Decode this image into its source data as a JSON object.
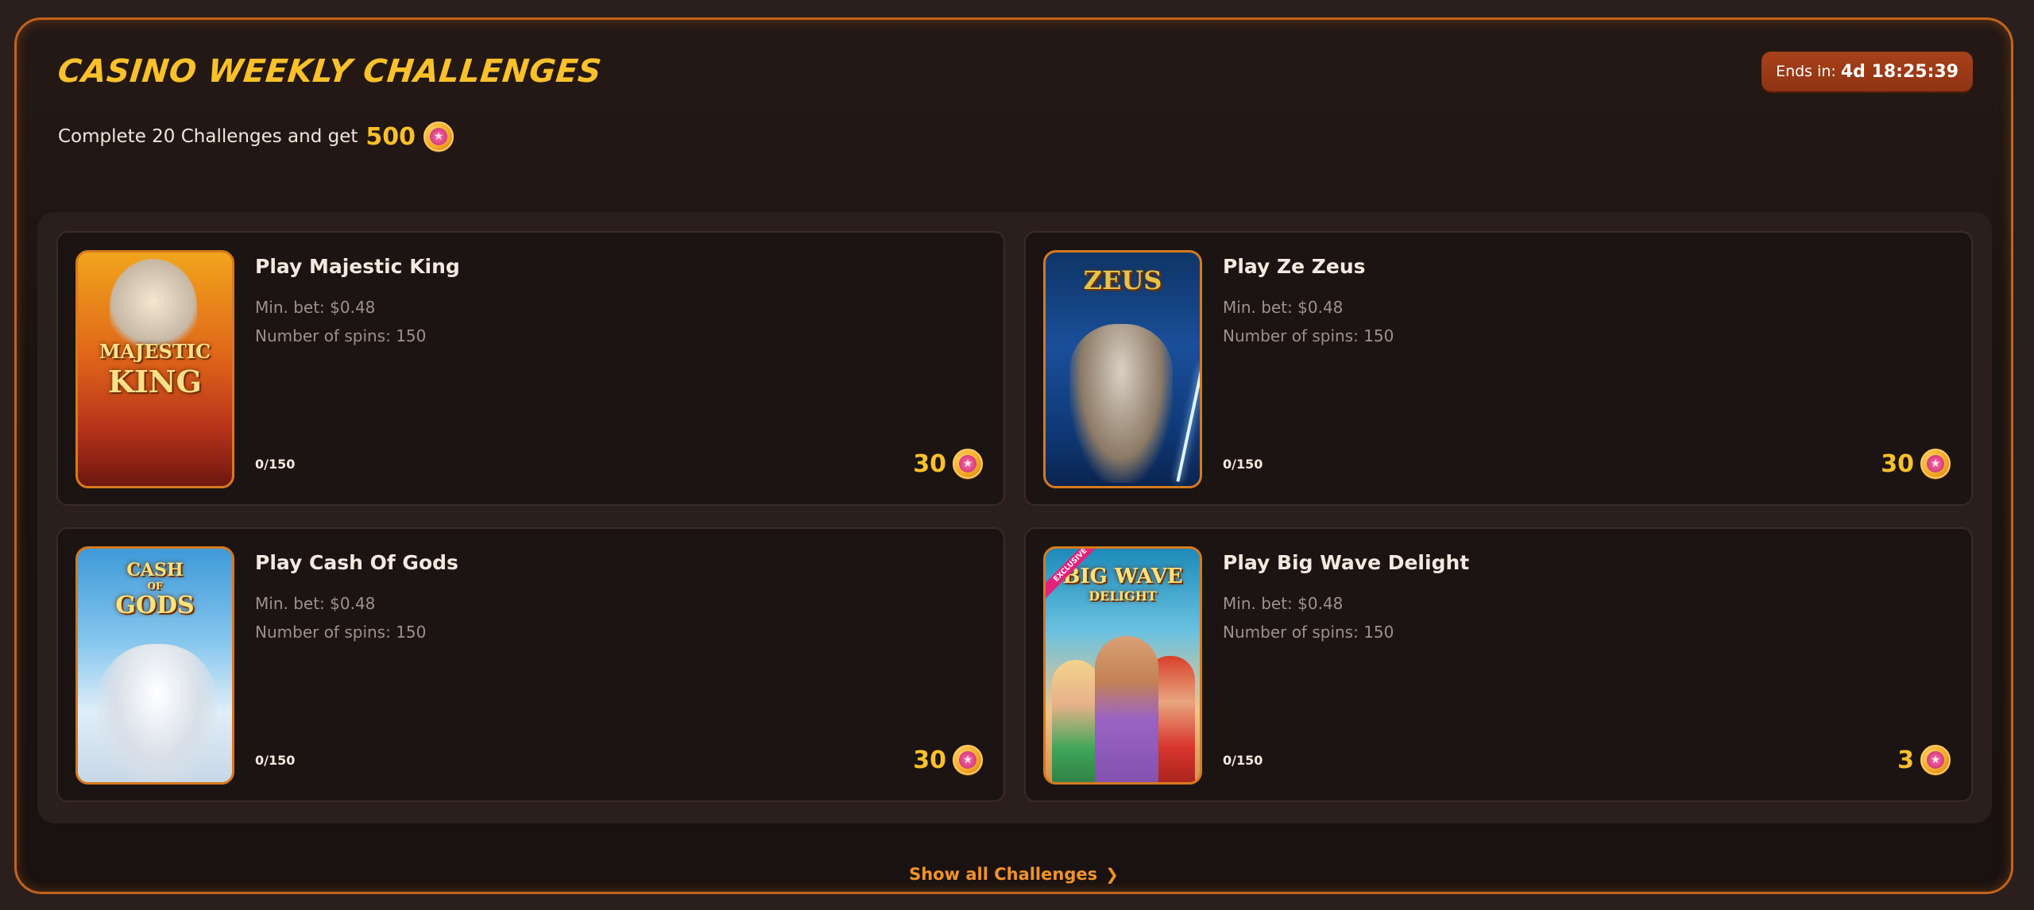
{
  "header": {
    "title": "CASINO WEEKLY CHALLENGES",
    "subtitle": "Complete 20 Challenges and get",
    "reward": "500",
    "timer_label": "Ends in:",
    "timer_value": "4d 18:25:39"
  },
  "challenges": [
    {
      "title": "Play Majestic King",
      "thumb_text_1": "MAJESTIC",
      "thumb_text_2": "KING",
      "min_bet": "Min. bet: $0.48",
      "spins": "Number of spins: 150",
      "progress": "0/150",
      "reward": "30"
    },
    {
      "title": "Play Ze Zeus",
      "thumb_text_1": "ZEUS",
      "min_bet": "Min. bet: $0.48",
      "spins": "Number of spins: 150",
      "progress": "0/150",
      "reward": "30"
    },
    {
      "title": "Play Cash Of Gods",
      "thumb_text_1": "CASH",
      "thumb_text_2": "OF",
      "thumb_text_3": "GODS",
      "min_bet": "Min. bet: $0.48",
      "spins": "Number of spins: 150",
      "progress": "0/150",
      "reward": "30"
    },
    {
      "title": "Play Big Wave Delight",
      "thumb_text_1": "BIG WAVE",
      "thumb_text_2": "DELIGHT",
      "badge": "EXCLUSIVE",
      "min_bet": "Min. bet: $0.48",
      "spins": "Number of spins: 150",
      "progress": "0/150",
      "reward": "3"
    }
  ],
  "footer": {
    "show_all_label": "Show all Challenges",
    "chevron_icon": "chevron-right-icon"
  },
  "colors": {
    "accent": "#fbc12b",
    "border": "#c2631b",
    "link": "#f0932a"
  }
}
